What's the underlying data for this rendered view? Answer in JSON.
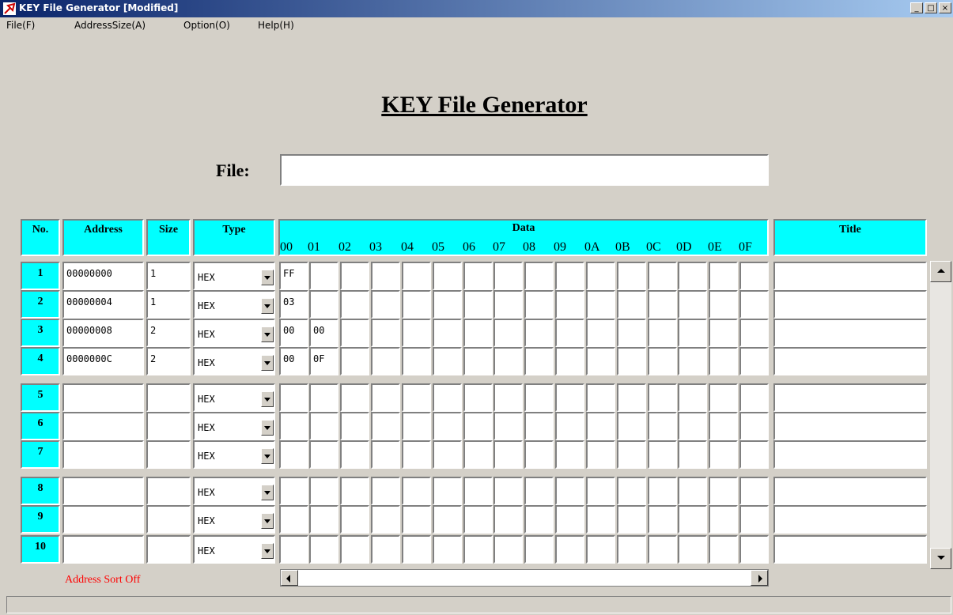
{
  "window": {
    "title": "KEY File Generator [Modified]",
    "minimize_glyph": "_",
    "maximize_glyph": "□",
    "close_glyph": "×"
  },
  "menu": [
    "File(F)",
    "AddressSize(A)",
    "Option(O)",
    "Help(H)"
  ],
  "heading": "KEY File Generator",
  "file": {
    "label": "File:",
    "value": ""
  },
  "table": {
    "headers": {
      "no": "No.",
      "address": "Address",
      "size": "Size",
      "type": "Type",
      "data": "Data",
      "title": "Title"
    },
    "byte_indices": [
      "00",
      "01",
      "02",
      "03",
      "04",
      "05",
      "06",
      "07",
      "08",
      "09",
      "0A",
      "0B",
      "0C",
      "0D",
      "0E",
      "0F"
    ],
    "rows": [
      {
        "no": "1",
        "address": "00000000",
        "size": "1",
        "type": "HEX",
        "data": [
          "FF"
        ],
        "title": ""
      },
      {
        "no": "2",
        "address": "00000004",
        "size": "1",
        "type": "HEX",
        "data": [
          "03"
        ],
        "title": ""
      },
      {
        "no": "3",
        "address": "00000008",
        "size": "2",
        "type": "HEX",
        "data": [
          "00",
          "00"
        ],
        "title": ""
      },
      {
        "no": "4",
        "address": "0000000C",
        "size": "2",
        "type": "HEX",
        "data": [
          "00",
          "0F"
        ],
        "title": ""
      },
      {
        "no": "5",
        "address": "",
        "size": "",
        "type": "HEX",
        "data": [],
        "title": ""
      },
      {
        "no": "6",
        "address": "",
        "size": "",
        "type": "HEX",
        "data": [],
        "title": ""
      },
      {
        "no": "7",
        "address": "",
        "size": "",
        "type": "HEX",
        "data": [],
        "title": ""
      },
      {
        "no": "8",
        "address": "",
        "size": "",
        "type": "HEX",
        "data": [],
        "title": ""
      },
      {
        "no": "9",
        "address": "",
        "size": "",
        "type": "HEX",
        "data": [],
        "title": ""
      },
      {
        "no": "10",
        "address": "",
        "size": "",
        "type": "HEX",
        "data": [],
        "title": ""
      }
    ]
  },
  "sort_status": "Address Sort Off",
  "colors": {
    "header_bg": "#00ffff",
    "window_bg": "#d4d0c8",
    "sort_status": "#ff0000"
  },
  "icons": {
    "app": "key-app-icon"
  }
}
